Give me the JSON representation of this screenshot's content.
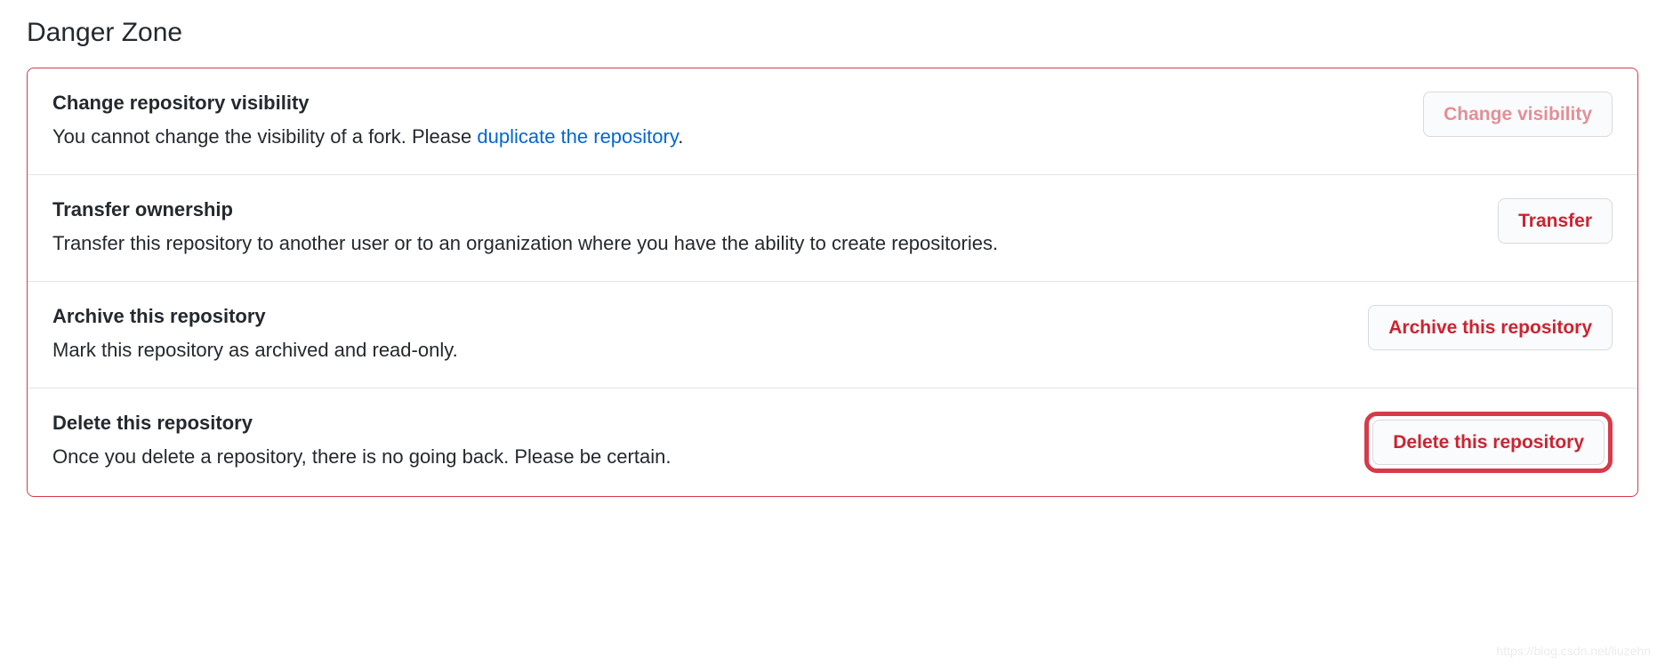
{
  "section": {
    "title": "Danger Zone"
  },
  "items": [
    {
      "heading": "Change repository visibility",
      "desc_prefix": "You cannot change the visibility of a fork. Please ",
      "desc_link": "duplicate the repository",
      "desc_suffix": ".",
      "button": "Change visibility",
      "button_disabled": true
    },
    {
      "heading": "Transfer ownership",
      "desc": "Transfer this repository to another user or to an organization where you have the ability to create repositories.",
      "button": "Transfer"
    },
    {
      "heading": "Archive this repository",
      "desc": "Mark this repository as archived and read-only.",
      "button": "Archive this repository"
    },
    {
      "heading": "Delete this repository",
      "desc": "Once you delete a repository, there is no going back. Please be certain.",
      "button": "Delete this repository",
      "highlighted": true
    }
  ],
  "watermark": "https://blog.csdn.net/liuzehn"
}
